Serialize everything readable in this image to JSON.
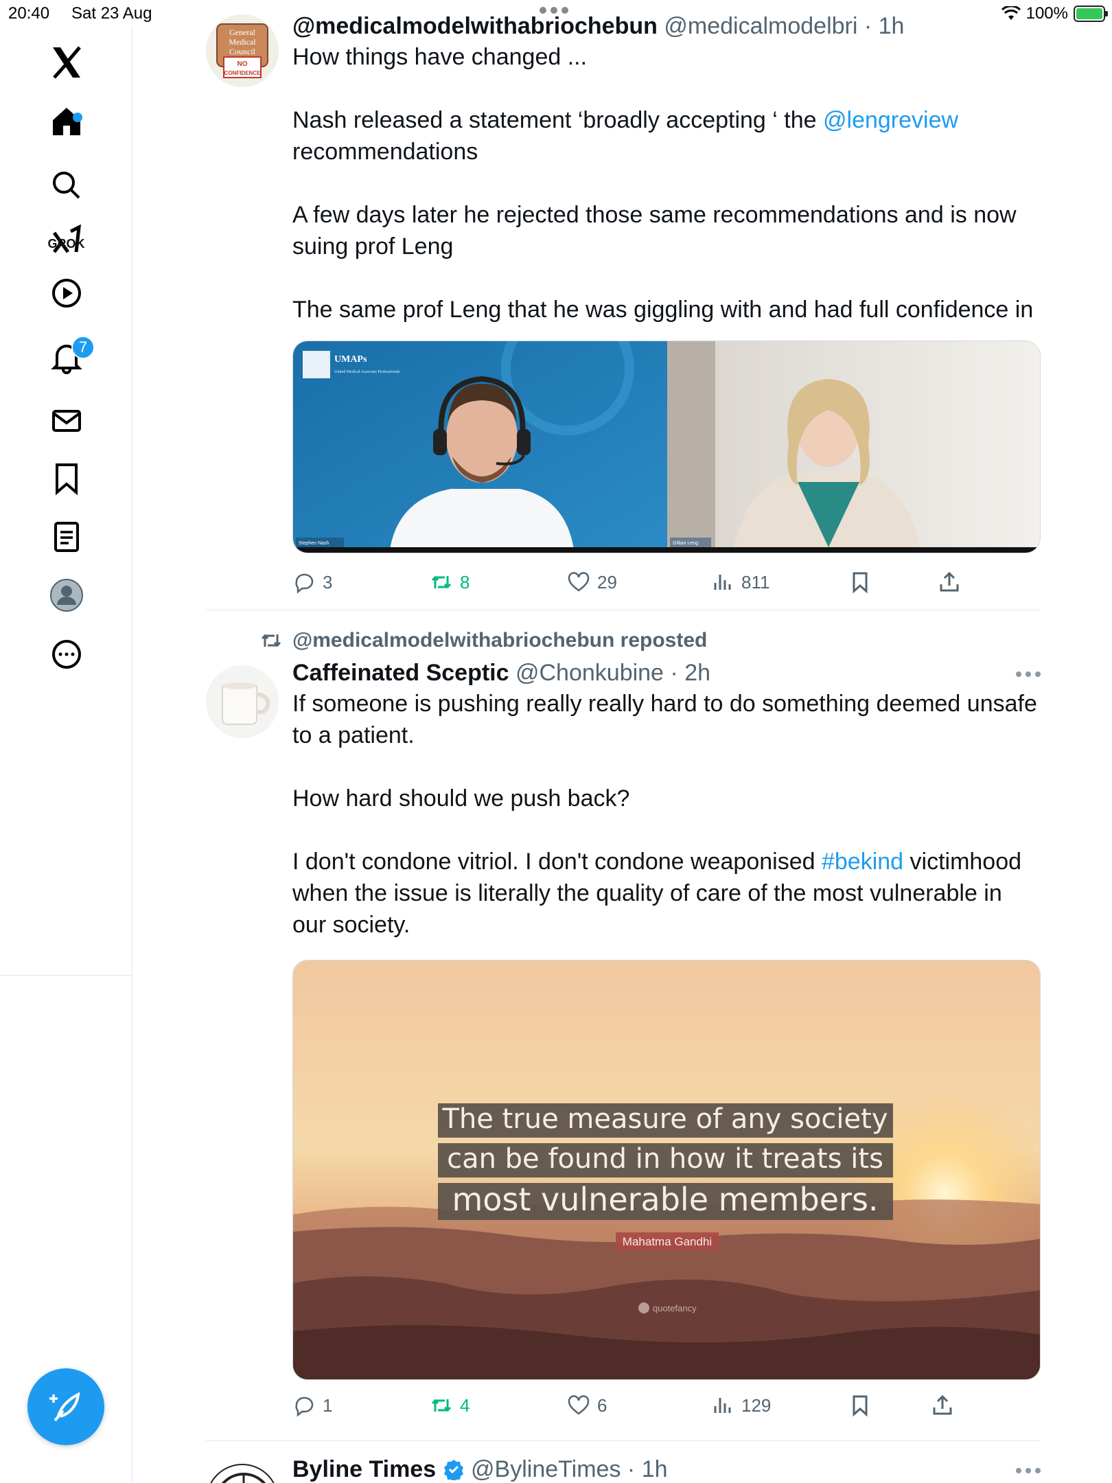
{
  "status_bar": {
    "time": "20:40",
    "date": "Sat 23 Aug",
    "battery_percent": "100%",
    "battery_level": 1.0
  },
  "sidebar": {
    "items": [
      {
        "name": "x-logo-icon"
      },
      {
        "name": "home-icon"
      },
      {
        "name": "search-icon"
      },
      {
        "name": "grok-icon",
        "label": "GROK"
      },
      {
        "name": "video-icon"
      },
      {
        "name": "notifications-icon",
        "badge": "7"
      },
      {
        "name": "messages-icon"
      },
      {
        "name": "bookmarks-icon"
      },
      {
        "name": "lists-icon"
      },
      {
        "name": "profile-icon"
      },
      {
        "name": "more-icon"
      }
    ],
    "compose_icon": "compose-feather-icon"
  },
  "posts": [
    {
      "display_name": "@medicalmodelwithabriochebun",
      "handle": "@medicalmodelbri",
      "time": "1h",
      "avatar_text": [
        "General",
        "Medical",
        "Council",
        "NO",
        "CONFIDENCE"
      ],
      "paragraphs": [
        [
          "How things have changed ..."
        ],
        [
          "Nash released a statement ‘broadly accepting ‘  the ",
          "@lengreview",
          " recommendations"
        ],
        [
          "A few days later he rejected those same recommendations and is now suing prof Leng"
        ],
        [
          "The same prof Leng that he was giggling with and had full confidence in"
        ]
      ],
      "media": {
        "left_panel_logo": "UMAPs",
        "left_panel_sub": "United Medical Associate Professionals",
        "left_caption": "Stephen Nash",
        "right_caption": "Gillian Leng"
      },
      "actions": {
        "replies": "3",
        "reposts": "8",
        "likes": "29",
        "views": "811"
      }
    },
    {
      "repost_note": "@medicalmodelwithabriochebun reposted",
      "display_name": "Caffeinated Sceptic",
      "handle": "@Chonkubine",
      "time": "2h",
      "paragraphs": [
        [
          "If someone is pushing really really hard to do something deemed unsafe to a patient."
        ],
        [
          "How hard should we push back?"
        ],
        [
          "I don't condone vitriol. I don't condone weaponised ",
          "#bekind",
          " victimhood when the issue is literally the quality of care of the most vulnerable in our society."
        ]
      ],
      "media": {
        "quote_lines": [
          "The true measure of any society",
          "can be found in how it treats its",
          "most vulnerable members."
        ],
        "quote_author": "Mahatma Gandhi",
        "watermark": "quotefancy"
      },
      "actions": {
        "replies": "1",
        "reposts": "4",
        "likes": "6",
        "views": "129"
      }
    },
    {
      "display_name": "Byline Times",
      "handle": "@BylineTimes",
      "time": "1h",
      "verified": true
    }
  ],
  "colors": {
    "accent": "#1d9bf0",
    "repost_green": "#00ba7c",
    "secondary_text": "#536471",
    "quote_box": "#5b5149",
    "author_box": "#a94a45"
  }
}
